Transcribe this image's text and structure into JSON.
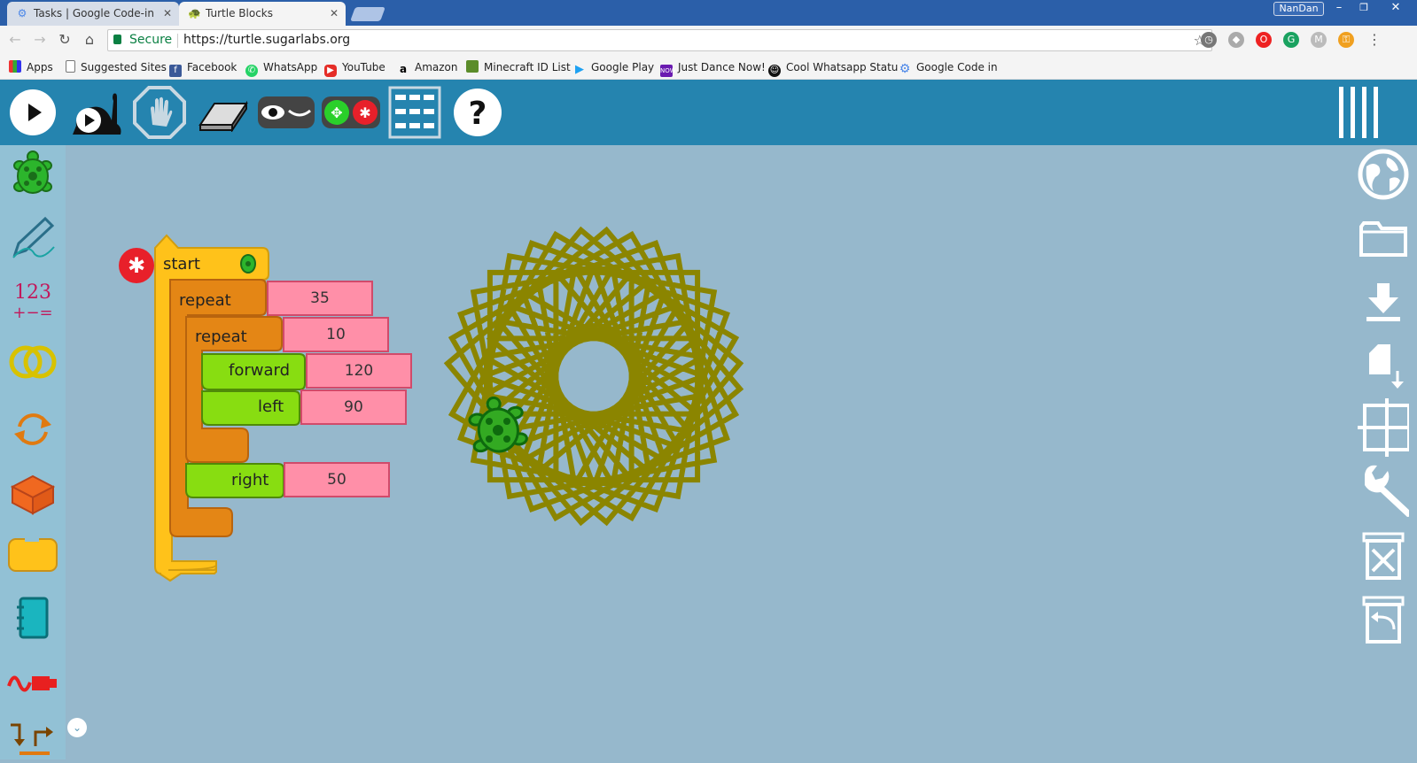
{
  "browser": {
    "tabs": [
      {
        "title": "Tasks | Google Code-in",
        "active": false
      },
      {
        "title": "Turtle Blocks",
        "active": true
      }
    ],
    "user": "NanDan",
    "window_controls": {
      "minimize": "–",
      "restore": "❐",
      "close": "✕"
    },
    "security_label": "Secure",
    "url": "https://turtle.sugarlabs.org",
    "bookmarks": [
      {
        "label": "Apps",
        "icon": "apps-grid-icon"
      },
      {
        "label": "Suggested Sites",
        "icon": "page-icon"
      },
      {
        "label": "Facebook",
        "icon": "facebook-icon"
      },
      {
        "label": "WhatsApp",
        "icon": "whatsapp-icon"
      },
      {
        "label": "YouTube",
        "icon": "youtube-icon"
      },
      {
        "label": "Amazon",
        "icon": "amazon-icon"
      },
      {
        "label": "Minecraft ID List",
        "icon": "minecraft-icon"
      },
      {
        "label": "Google Play",
        "icon": "google-play-icon"
      },
      {
        "label": "Just Dance Now!",
        "icon": "just-dance-icon"
      },
      {
        "label": "Cool Whatsapp Statu",
        "icon": "smiley-icon"
      },
      {
        "label": "Google Code in",
        "icon": "gear-icon"
      }
    ]
  },
  "toolbar": {
    "buttons": [
      "run-fast",
      "run-slow",
      "stop",
      "clear",
      "hide-blocks",
      "collapse-blocks",
      "block-grid",
      "help"
    ]
  },
  "palette": {
    "items": [
      "turtle",
      "pen",
      "number",
      "boolean",
      "flow",
      "action",
      "box",
      "media",
      "sensors",
      "extras"
    ]
  },
  "right_bar": {
    "items": [
      "menu",
      "language",
      "open-file",
      "save",
      "save-as",
      "grid",
      "settings",
      "delete-all",
      "restore"
    ]
  },
  "program": {
    "start_label": "start",
    "outer_repeat": {
      "label": "repeat",
      "value": "35"
    },
    "inner_repeat": {
      "label": "repeat",
      "value": "10"
    },
    "forward": {
      "label": "forward",
      "value": "120"
    },
    "left": {
      "label": "left",
      "value": "90"
    },
    "right": {
      "label": "right",
      "value": "50"
    }
  },
  "drawing": {
    "pen_color": "#8b8500",
    "canvas_bg": "#96b8cc",
    "turtle_color": "#33aa22"
  },
  "colors": {
    "toolbar": "#2584af",
    "palette": "#92c1d5",
    "start_block": "#ffc21a",
    "repeat_block": "#e48615",
    "motion_block": "#88dd11",
    "number_block": "#ff8fa8"
  }
}
